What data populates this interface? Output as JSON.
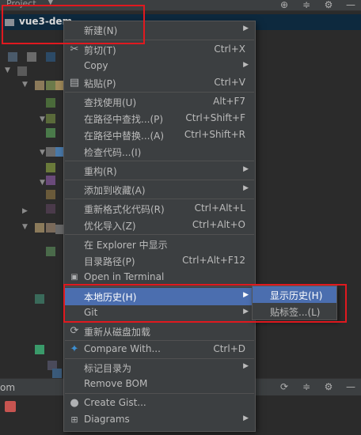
{
  "project_panel": {
    "title": "Project",
    "root_label": "vue3-dem",
    "header_icons": [
      "crosshair-icon",
      "collapse-icon",
      "gear-icon",
      "minimize-icon"
    ]
  },
  "context_menu": {
    "items": [
      {
        "label": "新建(N)",
        "shortcut": "",
        "submenu": true,
        "icon": ""
      },
      {
        "label": "剪切(T)",
        "shortcut": "Ctrl+X",
        "submenu": false,
        "icon": "scissors-icon"
      },
      {
        "label": "Copy",
        "shortcut": "",
        "submenu": true,
        "icon": ""
      },
      {
        "label": "粘贴(P)",
        "shortcut": "Ctrl+V",
        "submenu": false,
        "icon": "clipboard-icon"
      },
      {
        "label": "查找使用(U)",
        "shortcut": "Alt+F7",
        "submenu": false,
        "icon": ""
      },
      {
        "label": "在路径中查找...(P)",
        "shortcut": "Ctrl+Shift+F",
        "submenu": false,
        "icon": ""
      },
      {
        "label": "在路径中替换...(A)",
        "shortcut": "Ctrl+Shift+R",
        "submenu": false,
        "icon": ""
      },
      {
        "label": "检查代码...(I)",
        "shortcut": "",
        "submenu": false,
        "icon": ""
      },
      {
        "label": "重构(R)",
        "shortcut": "",
        "submenu": true,
        "icon": ""
      },
      {
        "label": "添加到收藏(A)",
        "shortcut": "",
        "submenu": true,
        "icon": ""
      },
      {
        "label": "重新格式化代码(R)",
        "shortcut": "Ctrl+Alt+L",
        "submenu": false,
        "icon": ""
      },
      {
        "label": "优化导入(Z)",
        "shortcut": "Ctrl+Alt+O",
        "submenu": false,
        "icon": ""
      },
      {
        "label": "在 Explorer 中显示",
        "shortcut": "",
        "submenu": false,
        "icon": ""
      },
      {
        "label": "目录路径(P)",
        "shortcut": "Ctrl+Alt+F12",
        "submenu": false,
        "icon": ""
      },
      {
        "label": "Open in Terminal",
        "shortcut": "",
        "submenu": false,
        "icon": "terminal-icon"
      },
      {
        "label": "本地历史(H)",
        "shortcut": "",
        "submenu": true,
        "icon": "",
        "highlighted": true
      },
      {
        "label": "Git",
        "shortcut": "",
        "submenu": true,
        "icon": ""
      },
      {
        "label": "重新从磁盘加载",
        "shortcut": "",
        "submenu": false,
        "icon": "reload-icon"
      },
      {
        "label": "Compare With...",
        "shortcut": "Ctrl+D",
        "submenu": false,
        "icon": "compare-icon"
      },
      {
        "label": "标记目录为",
        "shortcut": "",
        "submenu": true,
        "icon": ""
      },
      {
        "label": "Remove BOM",
        "shortcut": "",
        "submenu": false,
        "icon": ""
      },
      {
        "label": "Create Gist...",
        "shortcut": "",
        "submenu": false,
        "icon": "github-icon"
      },
      {
        "label": "Diagrams",
        "shortcut": "",
        "submenu": true,
        "icon": "diagrams-icon"
      }
    ]
  },
  "local_history_submenu": {
    "items": [
      {
        "label": "显示历史(H)",
        "highlighted": true
      },
      {
        "label": "贴标签...(L)",
        "highlighted": false
      }
    ]
  },
  "bottom_panel": {
    "label": "om",
    "header_icons": [
      "refresh-icon",
      "collapse-icon",
      "gear-icon",
      "minimize-icon"
    ]
  },
  "colors": {
    "menu_bg": "#3c3f41",
    "highlight": "#4b6eaf",
    "annotation_red": "#e0191f"
  }
}
